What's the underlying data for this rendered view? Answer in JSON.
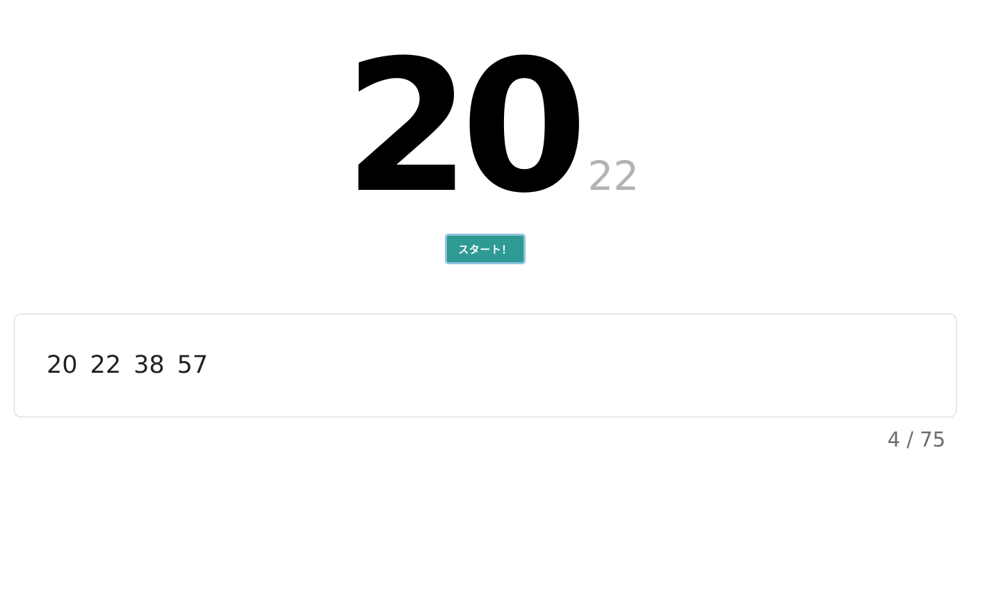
{
  "display": {
    "current_number": "20",
    "previous_number": "22"
  },
  "controls": {
    "start_label": "スタート！"
  },
  "history": {
    "numbers": [
      "20",
      "22",
      "38",
      "57"
    ]
  },
  "progress": {
    "drawn": 4,
    "total": 75,
    "text": "4 / 75"
  },
  "colors": {
    "accent": "#2f9a94",
    "button_border": "#8fc2de",
    "previous_number": "#b3b3b3",
    "counter": "#6b6b6b"
  }
}
